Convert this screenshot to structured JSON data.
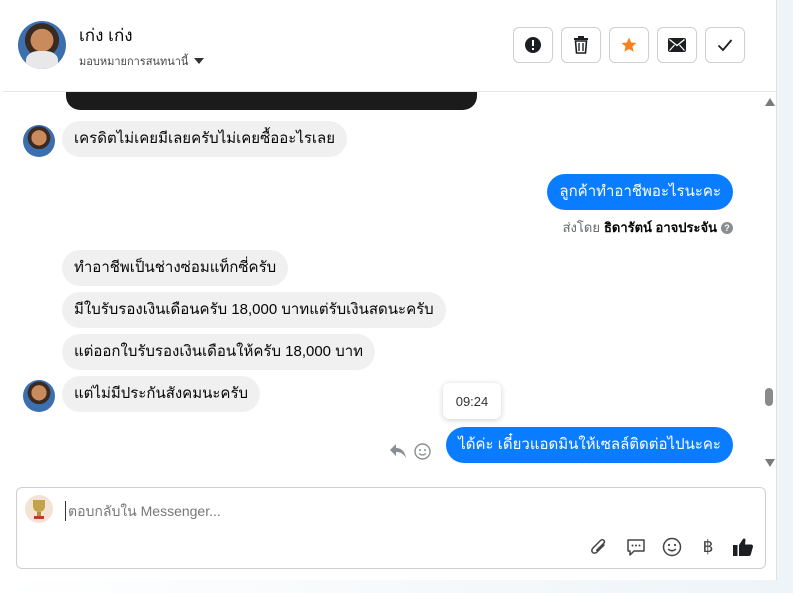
{
  "header": {
    "contact_name": "เก่ง เก่ง",
    "assign_label": "มอบหมายการสนทนานี้",
    "buttons": [
      "spam-button",
      "delete-button",
      "star-button",
      "mark-unread-button",
      "done-button"
    ],
    "star_color": "#f5821f"
  },
  "messages": {
    "m1": "เครดิตไม่เคยมีเลยครับไม่เคยซื้ออะไรเลย",
    "m2": "ลูกค้าทำอาชีพอะไรนะคะ",
    "sent_by_prefix": "ส่งโดย",
    "sent_by_name": "ธิดารัตน์ อาจประจัน",
    "m3": "ทำอาชีพเป็นช่างซ่อมแท็กซี่ครับ",
    "m4": "มีใบรับรองเงินเดือนครับ 18,000 บาทแต่รับเงินสดนะครับ",
    "m5": "แต่ออกใบรับรองเงินเดือนให้ครับ 18,000 บาท",
    "m6": "แต่ไม่มีประกันสังคมนะครับ",
    "tooltip_time": "09:24",
    "m7": "ได้ค่ะ เดี๋ยวแอดมินให้เซลล์ติดต่อไปนะคะ",
    "outgoing_color": "#0a7cff"
  },
  "composer": {
    "placeholder": "ตอบกลับใน Messenger...",
    "tools": [
      "attach-icon",
      "saved-reply-icon",
      "emoji-icon",
      "baht-icon",
      "thumbs-up-icon"
    ]
  }
}
